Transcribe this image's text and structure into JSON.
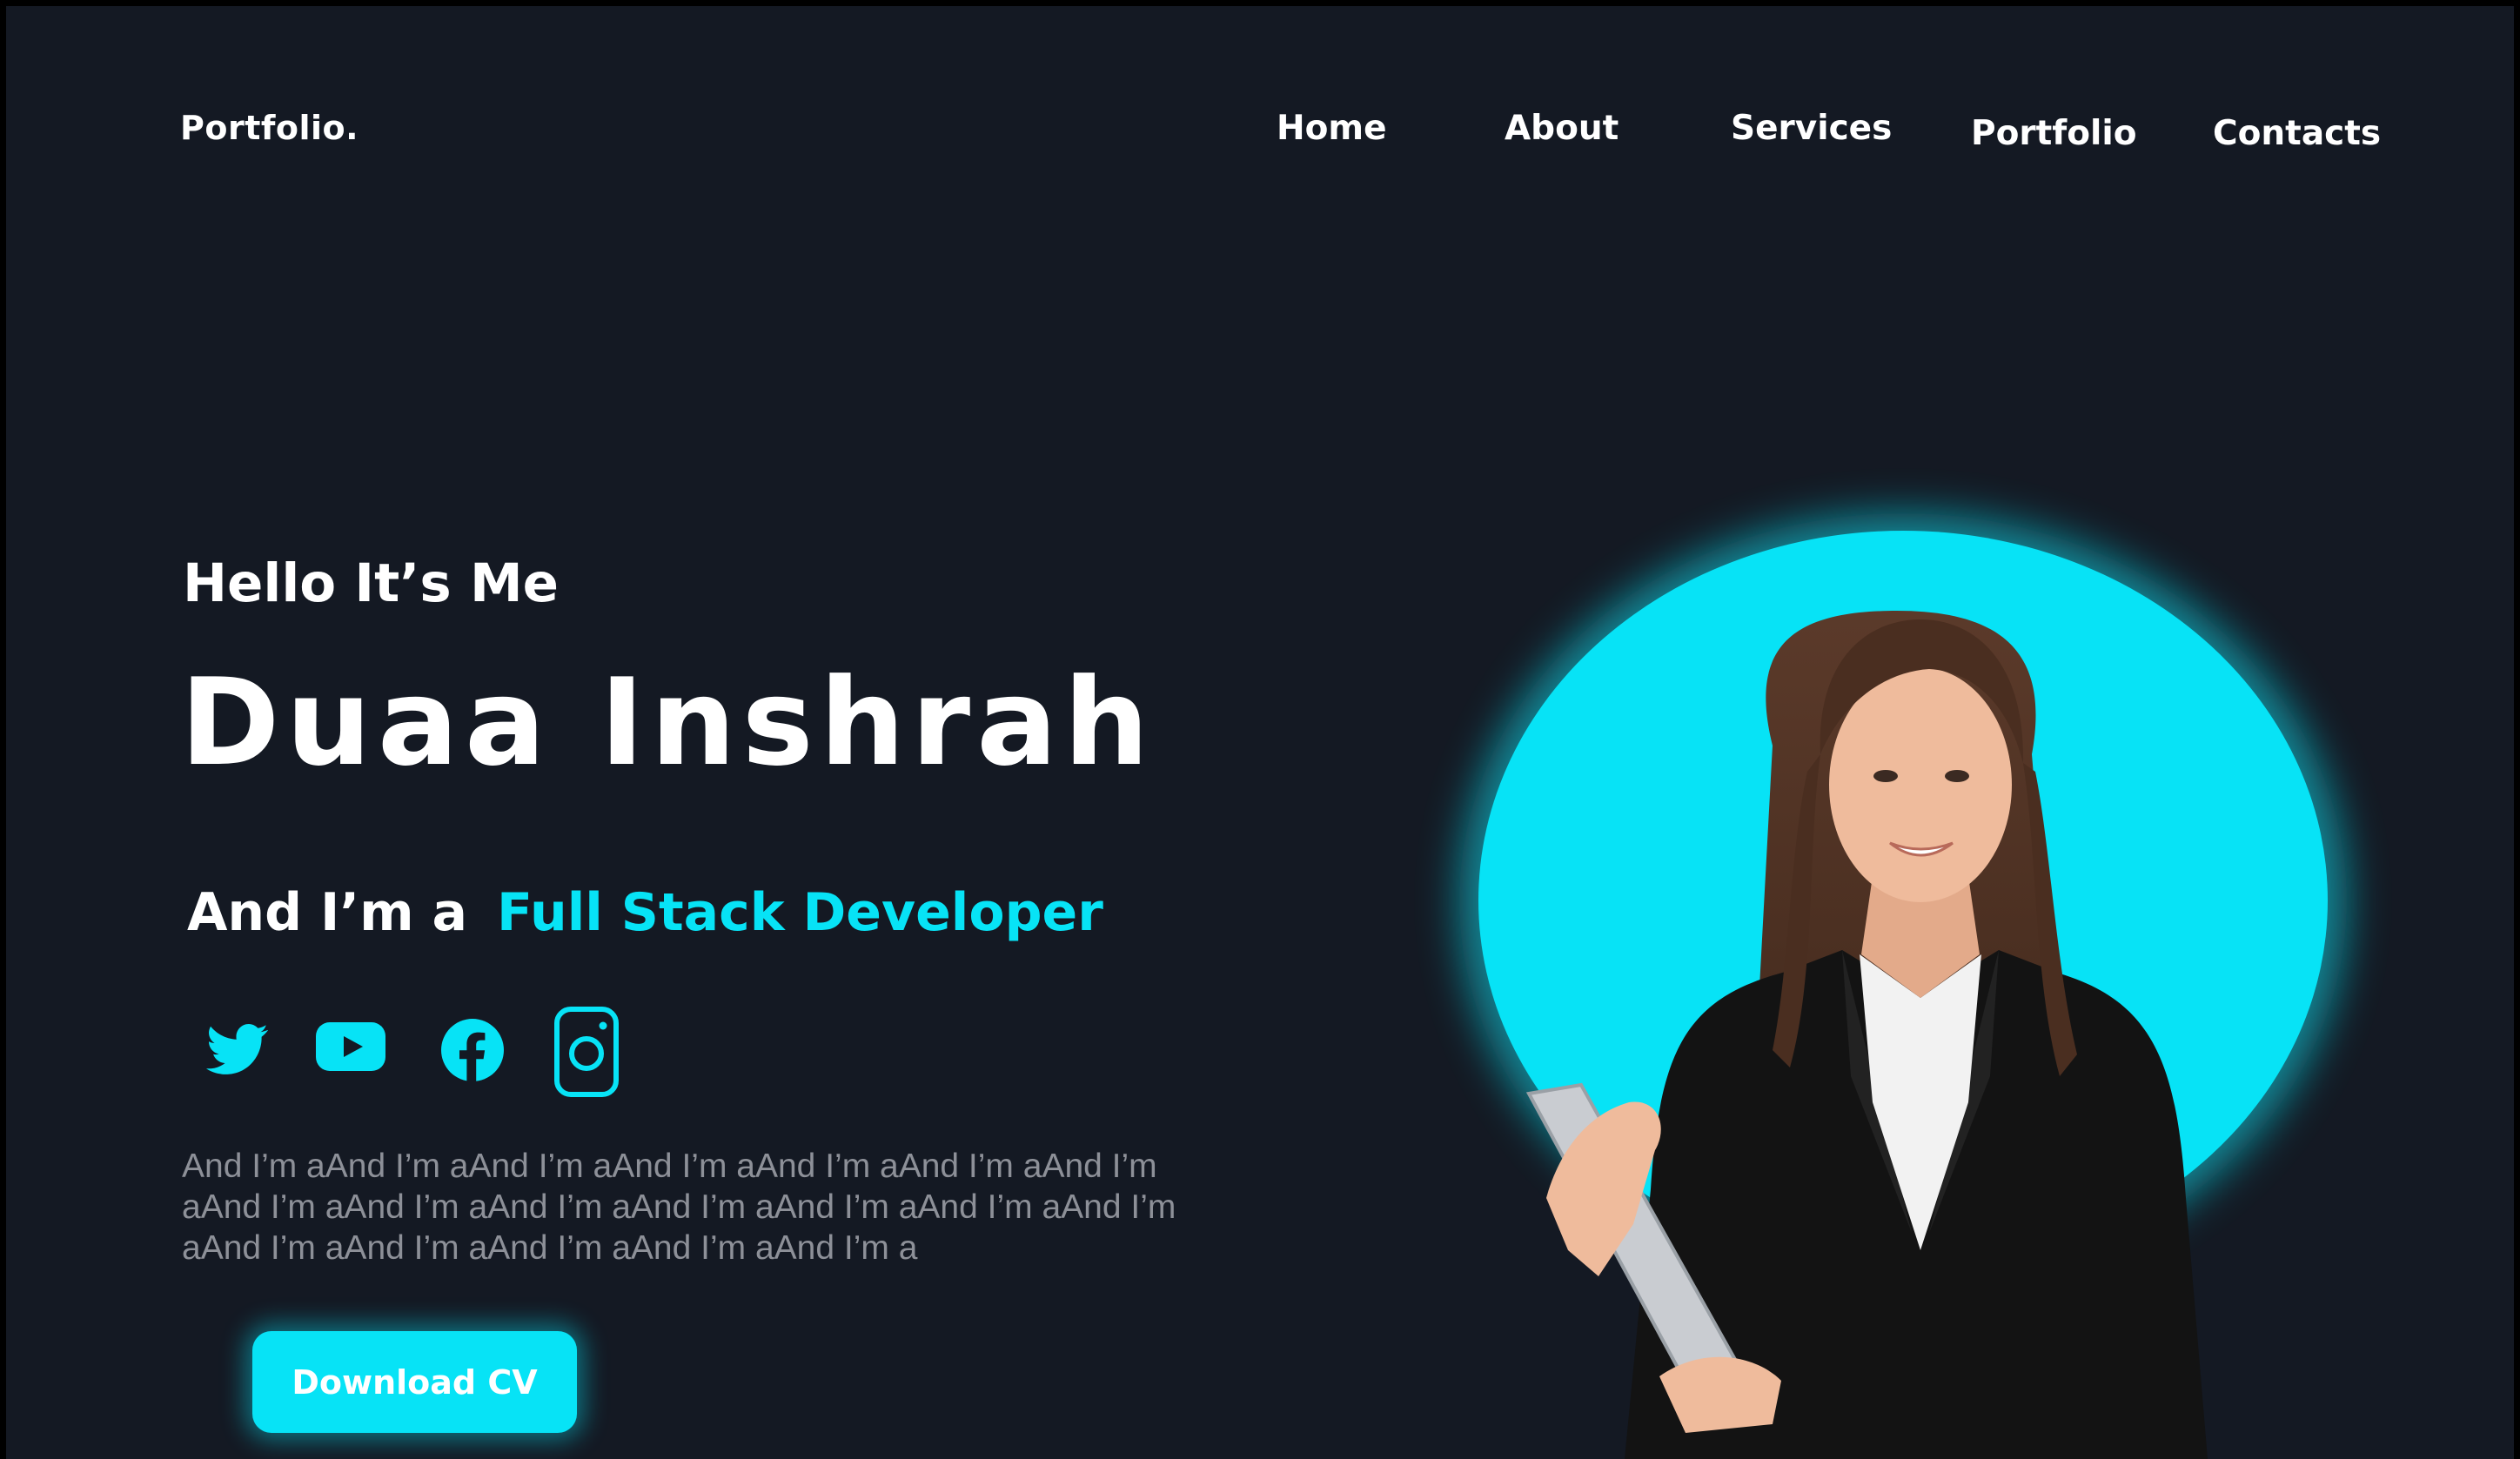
{
  "brand": {
    "logo": "Portfolio."
  },
  "nav": {
    "items": [
      {
        "label": "Home"
      },
      {
        "label": "About"
      },
      {
        "label": "Services"
      },
      {
        "label": "Portfolio"
      },
      {
        "label": "Contacts"
      }
    ]
  },
  "hero": {
    "greeting": "Hello It’s Me",
    "name": "Duaa Inshrah",
    "role_prefix": "And I’m a",
    "role": "Full Stack Developer",
    "bio": "And I’m aAnd I’m aAnd I’m aAnd I’m aAnd I’m aAnd I’m aAnd I’m aAnd I’m aAnd I’m aAnd I’m aAnd I’m aAnd I’m aAnd I’m aAnd I’m aAnd I’m aAnd I’m aAnd I’m aAnd I’m aAnd I’m a",
    "cta_label": "Download CV",
    "portrait_icon": "woman-in-suit-holding-tablet-photo"
  },
  "socials": [
    {
      "icon": "twitter-icon"
    },
    {
      "icon": "youtube-icon"
    },
    {
      "icon": "facebook-icon"
    },
    {
      "icon": "instagram-icon"
    }
  ],
  "colors": {
    "background": "#141923",
    "accent": "#07e3f6",
    "text": "#ffffff",
    "muted_text": "#8d9098"
  }
}
